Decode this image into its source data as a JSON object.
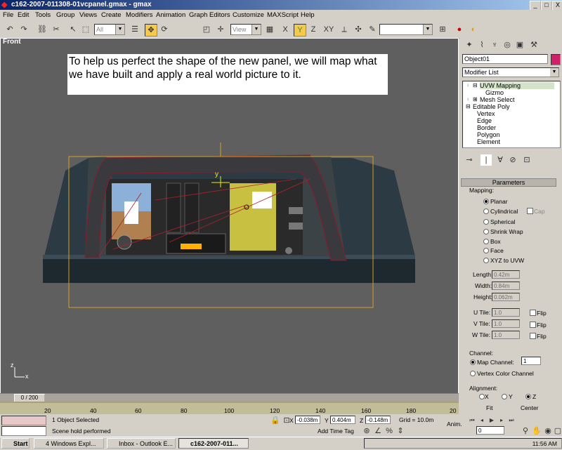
{
  "window": {
    "title": "c162-2007-011308-01vcpanel.gmax - gmax",
    "buttons": [
      "_",
      "□",
      "X"
    ]
  },
  "menu": [
    "File",
    "Edit",
    "Tools",
    "Group",
    "Views",
    "Create",
    "Modifiers",
    "Animation",
    "Graph Editors",
    "Customize",
    "MAXScript",
    "Help"
  ],
  "toolbar": {
    "selection_filter": "All",
    "coord_system": "View",
    "axis_labels": [
      "X",
      "Y",
      "Z",
      "XY"
    ]
  },
  "viewport": {
    "label": "Front",
    "caption": "To help us perfect the shape of the new panel, we will map what we have built and apply a real world picture to it.",
    "pivot_label": "y",
    "axis_x": "x",
    "axis_z": "z"
  },
  "command_panel": {
    "object_name": "Object01",
    "modifier_list": "Modifier List",
    "stack": [
      {
        "label": "UVW Mapping",
        "indent": 1,
        "selected": true
      },
      {
        "label": "Gizmo",
        "indent": 2
      },
      {
        "label": "Mesh Select",
        "indent": 1
      },
      {
        "label": "Editable Poly",
        "indent": 0
      },
      {
        "label": "Vertex",
        "indent": 2
      },
      {
        "label": "Edge",
        "indent": 2
      },
      {
        "label": "Border",
        "indent": 2
      },
      {
        "label": "Polygon",
        "indent": 2
      },
      {
        "label": "Element",
        "indent": 2
      }
    ],
    "parameters_title": "Parameters",
    "mapping_label": "Mapping:",
    "mapping_options": [
      "Planar",
      "Cylindrical",
      "Spherical",
      "Shrink Wrap",
      "Box",
      "Face",
      "XYZ to UVW"
    ],
    "mapping_selected": "Planar",
    "cap_label": "Cap",
    "length_label": "Length:",
    "length_value": "0.42m",
    "width_label": "Width:",
    "width_value": "0.84m",
    "height_label": "Height:",
    "height_value": "0.062m",
    "utile_label": "U Tile:",
    "utile_value": "1.0",
    "vtile_label": "V Tile:",
    "vtile_value": "1.0",
    "wtile_label": "W Tile:",
    "wtile_value": "1.0",
    "flip_label": "Flip",
    "channel_label": "Channel:",
    "map_channel_label": "Map Channel:",
    "map_channel_value": "1",
    "vertex_color_label": "Vertex Color Channel",
    "alignment_label": "Alignment:",
    "align_axes": [
      "X",
      "Y",
      "Z"
    ],
    "align_selected": "Z",
    "fit_label": "Fit",
    "center_label": "Center"
  },
  "timeline": {
    "frame_display": "0 / 200",
    "ticks": [
      "20",
      "40",
      "60",
      "80",
      "100",
      "120",
      "140",
      "160",
      "180",
      "20"
    ]
  },
  "status": {
    "selection": "1 Object Selected",
    "prompt": "Scene hold performed",
    "x_label": "X",
    "x_value": "-0.038m",
    "y_label": "Y",
    "y_value": "0.404m",
    "z_label": "Z",
    "z_value": "-0.148m",
    "grid": "Grid = 10.0m",
    "add_time_tag": "Add Time Tag",
    "anim": "Anim.",
    "frame_value": "0"
  },
  "taskbar": {
    "start": "Start",
    "tasks": [
      "4 Windows Expl...",
      "Inbox - Outlook E...",
      "c162-2007-011..."
    ],
    "clock": "11:56 AM"
  }
}
